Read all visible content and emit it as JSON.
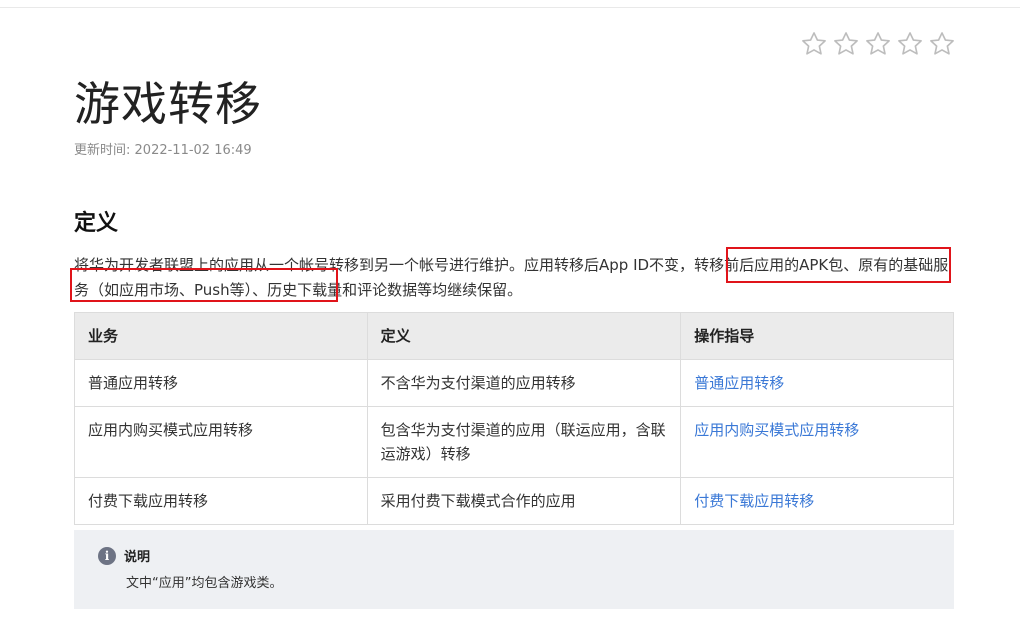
{
  "rating": {
    "stars": [
      "star-1",
      "star-2",
      "star-3",
      "star-4",
      "star-5"
    ],
    "star_color": "#bdbdbd"
  },
  "page": {
    "title": "游戏转移",
    "updated_label": "更新时间:",
    "updated_value": "2022-11-02 16:49"
  },
  "definition": {
    "heading": "定义",
    "text_part1": "将华为开发者联盟上的应用从一个帐号转移到另一个帐号进行维护。应用转移后App ID不变，",
    "text_highlight": "转移前后应用的APK包、原有的基础服务（如应用市场、Push等）",
    "text_part2": "、历史下载量和评论数据等均继续保留。",
    "highlight_color": "#e0141a"
  },
  "table": {
    "headers": [
      "业务",
      "定义",
      "操作指导"
    ],
    "rows": [
      {
        "business": "普通应用转移",
        "definition": "不含华为支付渠道的应用转移",
        "guide": "普通应用转移"
      },
      {
        "business": "应用内购买模式应用转移",
        "definition": "包含华为支付渠道的应用（联运应用，含联运游戏）转移",
        "guide": "应用内购买模式应用转移"
      },
      {
        "business": "付费下载应用转移",
        "definition": "采用付费下载模式合作的应用",
        "guide": "付费下载应用转移"
      }
    ],
    "link_color": "#3a78d6"
  },
  "note": {
    "icon": "info-icon",
    "title": "说明",
    "text": "文中“应用”均包含游戏类。"
  }
}
